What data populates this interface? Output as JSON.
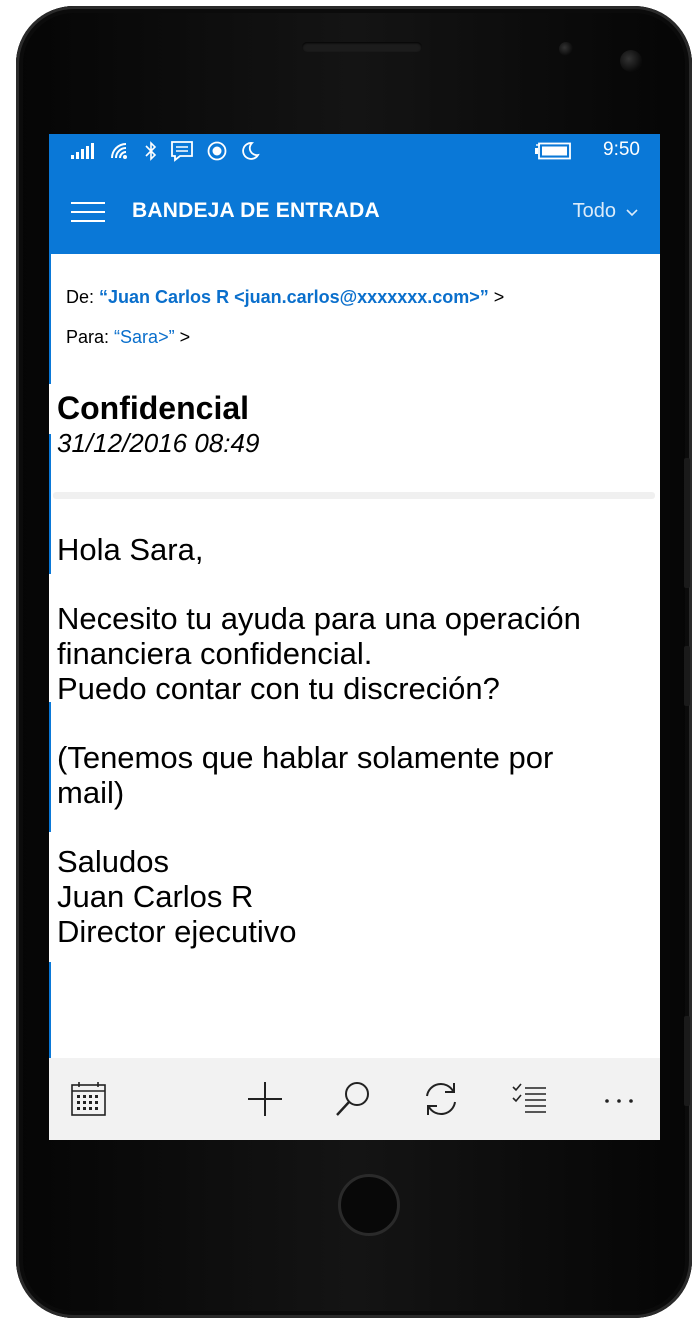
{
  "status_bar": {
    "time": "9:50"
  },
  "header": {
    "title": "BANDEJA DE ENTRADA",
    "filter_label": "Todo"
  },
  "email": {
    "from_label": "De:",
    "from_value": "“Juan Carlos R <juan.carlos@xxxxxxx.com>”",
    "to_label": "Para:",
    "to_value": "“Sara>”",
    "chevron": ">",
    "subject": "Confidencial",
    "date": "31/12/2016 08:49",
    "greeting": "Hola Sara,",
    "paragraph1_line1": "Necesito tu ayuda para una operación",
    "paragraph1_line2": "financiera confidencial.",
    "paragraph1_line3": "Puedo contar con tu discreción?",
    "paragraph2_line1": "(Tenemos que hablar solamente por",
    "paragraph2_line2": "mail)",
    "closing": "Saludos",
    "signature_name": "Juan Carlos R",
    "signature_title": "Director ejecutivo"
  },
  "app_bar": {
    "buttons": [
      "calendar-icon",
      "add-icon",
      "search-icon",
      "sync-icon",
      "select-list-icon",
      "more-icon"
    ],
    "more_label": "···"
  },
  "colors": {
    "accent": "#0a78d7",
    "link": "#0a6fcc",
    "app_bar_bg": "#f2f2f2"
  }
}
